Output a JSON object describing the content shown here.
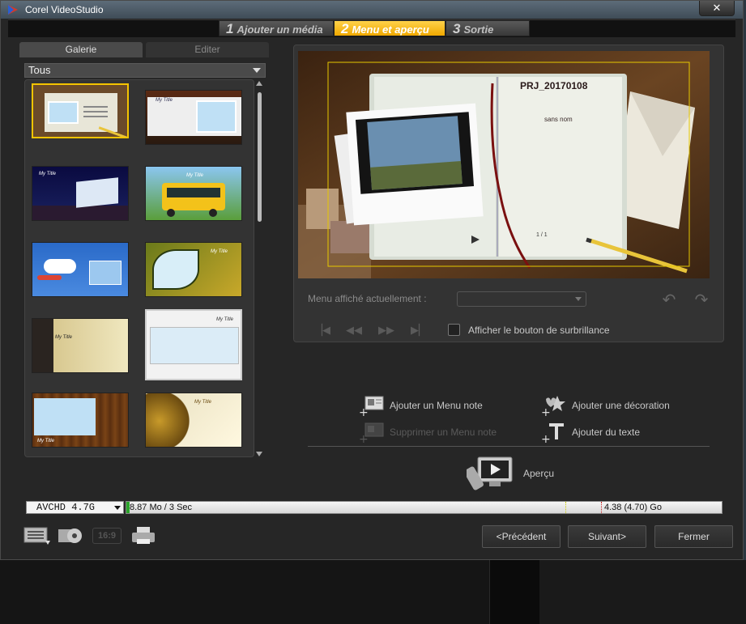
{
  "window": {
    "title": "Corel VideoStudio",
    "close": "✕"
  },
  "steps": [
    {
      "num": "1",
      "label": "Ajouter un média",
      "active": false
    },
    {
      "num": "2",
      "label": "Menu et aperçu",
      "active": true
    },
    {
      "num": "3",
      "label": "Sortie",
      "active": false
    }
  ],
  "gallery": {
    "tabs": [
      "Galerie",
      "Editer"
    ],
    "filter": "Tous",
    "thumb_text": "My Title"
  },
  "preview": {
    "project_title": "PRJ_20170108",
    "subtitle": "sans nom",
    "page": "1 / 1",
    "menu_label": "Menu affiché actuellement :",
    "highlight_label": "Afficher le bouton de surbrillance"
  },
  "actions": {
    "add_menu_note": "Ajouter un Menu note",
    "remove_menu_note": "Supprimer un Menu note",
    "add_decoration": "Ajouter une décoration",
    "add_text": "Ajouter du texte",
    "preview": "Aperçu"
  },
  "disk": {
    "format": "AVCHD 4.7G",
    "used_label": "8.87 Mo / 3 Sec",
    "capacity_label": "4.38 (4.70) Go",
    "used_fraction": 0.005
  },
  "footer": {
    "aspect": "16:9",
    "prev": "<Précédent",
    "next": "Suivant>",
    "close": "Fermer"
  },
  "colors": {
    "accent": "#f0a800",
    "selection": "#f5c400",
    "disk_used": "#2aa52a"
  }
}
